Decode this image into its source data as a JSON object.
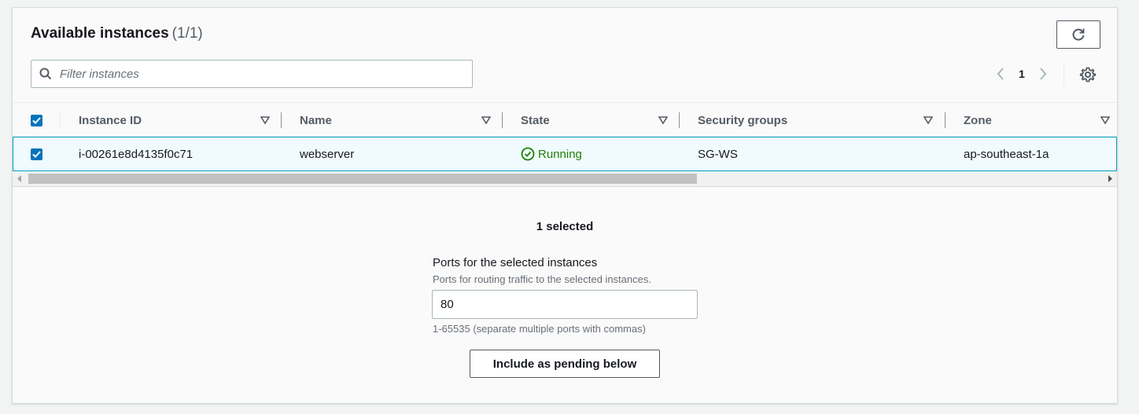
{
  "header": {
    "title": "Available instances",
    "count": "(1/1)"
  },
  "filter": {
    "placeholder": "Filter instances",
    "value": ""
  },
  "pagination": {
    "current_page": "1"
  },
  "table": {
    "columns": [
      "Instance ID",
      "Name",
      "State",
      "Security groups",
      "Zone"
    ],
    "rows": [
      {
        "selected": true,
        "instance_id": "i-00261e8d4135f0c71",
        "name": "webserver",
        "state": "Running",
        "security_groups": "SG-WS",
        "zone": "ap-southeast-1a"
      }
    ]
  },
  "selection": {
    "summary": "1 selected"
  },
  "ports": {
    "label": "Ports for the selected instances",
    "description": "Ports for routing traffic to the selected instances.",
    "value": "80",
    "hint": "1-65535 (separate multiple ports with commas)"
  },
  "actions": {
    "include_label": "Include as pending below"
  },
  "colors": {
    "accent": "#0073bb",
    "running": "#1d8102",
    "row_highlight": "#f1faff",
    "row_border": "#00a1c9"
  }
}
